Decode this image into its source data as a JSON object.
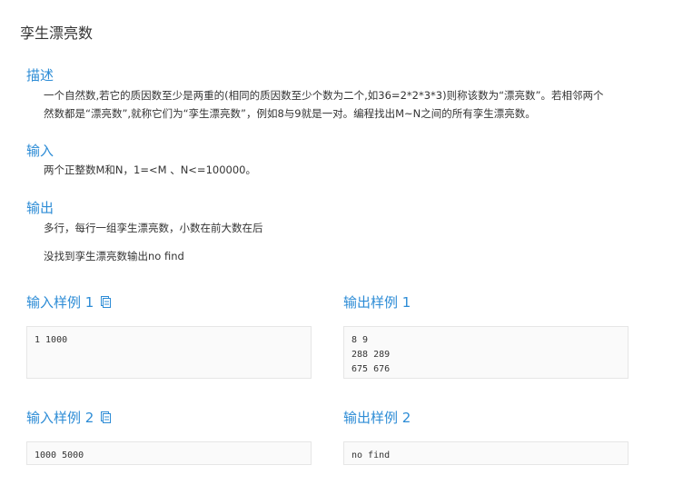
{
  "problem": {
    "title": "孪生漂亮数",
    "sections": {
      "description": {
        "heading": "描述",
        "lines": [
          "一个自然数,若它的质因数至少是两重的(相同的质因数至少个数为二个,如36=2*2*3*3)则称该数为“漂亮数”。若相邻两个",
          "然数都是“漂亮数”,就称它们为“孪生漂亮数”，例如8与9就是一对。编程找出M~N之间的所有孪生漂亮数。"
        ]
      },
      "input": {
        "heading": "输入",
        "text": "两个正整数M和N，1=<M 、N<=100000。"
      },
      "output": {
        "heading": "输出",
        "line1": "多行，每行一组孪生漂亮数，小数在前大数在后",
        "line2": "没找到孪生漂亮数输出no find"
      }
    },
    "samples": [
      {
        "input_title": "输入样例 1",
        "input": "1 1000",
        "output_title": "输出样例 1",
        "output": "8 9\n288 289\n675 676"
      },
      {
        "input_title": "输入样例 2",
        "input": "1000 5000",
        "output_title": "输出样例 2",
        "output": "no find"
      }
    ]
  },
  "icons": {
    "copy": "copy-icon"
  },
  "colors": {
    "heading": "#2d8cd6",
    "text": "#333333",
    "box_bg": "#fafafa",
    "box_border": "#e6e6e6"
  }
}
